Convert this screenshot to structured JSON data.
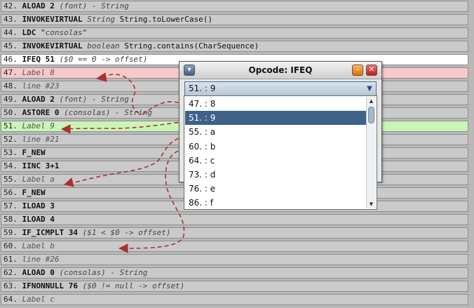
{
  "instructions": [
    {
      "num": "42.",
      "op": "ALOAD 2",
      "rest": " ",
      "comment": "(font) - String",
      "style": "normal"
    },
    {
      "num": "43.",
      "op": "INVOKEVIRTUAL",
      "rest": " ",
      "comment": "String",
      "tail": " String.toLowerCase()",
      "style": "normal"
    },
    {
      "num": "44.",
      "op": "LDC",
      "rest": " \"",
      "comment": "consolas",
      "tail": "\"",
      "style": "normal"
    },
    {
      "num": "45.",
      "op": "INVOKEVIRTUAL",
      "rest": " ",
      "comment": "boolean",
      "tail": " String.contains(CharSequence)",
      "style": "normal"
    },
    {
      "num": "46.",
      "op": "IFEQ 51",
      "rest": " ",
      "comment": "($0 == 0 -> offset)",
      "style": "white"
    },
    {
      "num": "47.",
      "label": "Label 8",
      "style": "pink"
    },
    {
      "num": "48.",
      "label": "line #23",
      "style": "normal"
    },
    {
      "num": "49.",
      "op": "ALOAD 2",
      "rest": " ",
      "comment": "(font) - String",
      "style": "normal"
    },
    {
      "num": "50.",
      "op": "ASTORE 0",
      "rest": " ",
      "comment": "(consolas) - String",
      "style": "normal"
    },
    {
      "num": "51.",
      "label": "Label 9",
      "style": "green"
    },
    {
      "num": "52.",
      "label": "line #21",
      "style": "normal"
    },
    {
      "num": "53.",
      "op": "F_NEW",
      "style": "normal"
    },
    {
      "num": "54.",
      "op": "IINC 3+1",
      "style": "normal"
    },
    {
      "num": "55.",
      "label": "Label a",
      "style": "normal"
    },
    {
      "num": "56.",
      "op": "F_NEW",
      "style": "normal"
    },
    {
      "num": "57.",
      "op": "ILOAD 3",
      "style": "normal"
    },
    {
      "num": "58.",
      "op": "ILOAD 4",
      "style": "normal"
    },
    {
      "num": "59.",
      "op": "IF_ICMPLT 34",
      "rest": " ",
      "comment": "($1 < $0 -> offset)",
      "style": "normal"
    },
    {
      "num": "60.",
      "label": "Label b",
      "style": "normal"
    },
    {
      "num": "61.",
      "label": "line #26",
      "style": "normal"
    },
    {
      "num": "62.",
      "op": "ALOAD 0",
      "rest": " ",
      "comment": "(consolas) - String",
      "style": "normal"
    },
    {
      "num": "63.",
      "op": "IFNONNULL 76",
      "rest": " ",
      "comment": "($0 != null -> offset)",
      "style": "normal"
    },
    {
      "num": "64.",
      "label": "Label c",
      "style": "normal"
    }
  ],
  "dialog": {
    "title": "Opcode: IFEQ",
    "selected_value": "51. : 9",
    "options": [
      "47. : 8",
      "51. : 9",
      "55. : a",
      "60. : b",
      "64. : c",
      "73. : d",
      "76. : e",
      "86. : f"
    ],
    "selected_index": 1
  },
  "colors": {
    "highlight_pink": "#f8c9c9",
    "highlight_green": "#c9f5b8",
    "selection_blue": "#3e6289",
    "annotation_red": "#a83232"
  },
  "icons": {
    "menu": "chevron-down-icon",
    "minimize": "minimize-icon",
    "close": "close-icon",
    "combo": "triangle-down-icon"
  }
}
